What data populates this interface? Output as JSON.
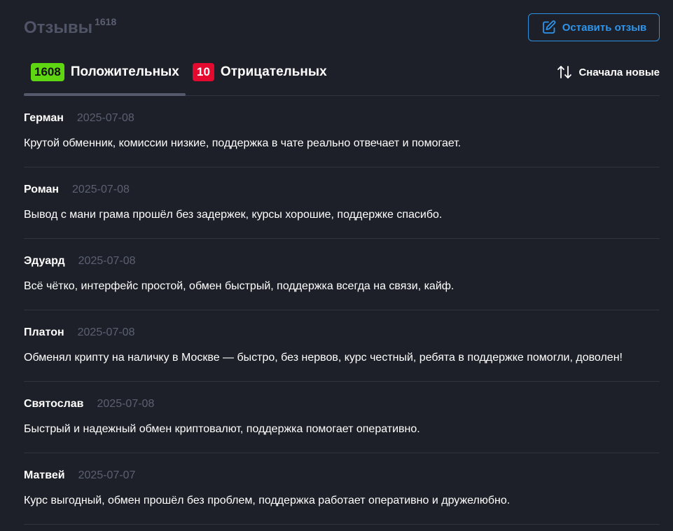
{
  "header": {
    "title": "Отзывы",
    "count": "1618",
    "leave_review_label": "Оставить отзыв"
  },
  "tabs": {
    "positive": {
      "count": "1608",
      "label": "Положительных"
    },
    "negative": {
      "count": "10",
      "label": "Отрицательных"
    }
  },
  "sort": {
    "label": "Сначала новые"
  },
  "reviews": [
    {
      "author": "Герман",
      "date": "2025-07-08",
      "text": "Крутой обменник, комиссии низкие, поддержка в чате реально отвечает и помогает."
    },
    {
      "author": "Роман",
      "date": "2025-07-08",
      "text": "Вывод с мани грама прошёл без задержек, курсы хорошие, поддержке спасибо."
    },
    {
      "author": "Эдуард",
      "date": "2025-07-08",
      "text": "Всё чётко, интерфейс простой, обмен быстрый, поддержка всегда на связи, кайф."
    },
    {
      "author": "Платон",
      "date": "2025-07-08",
      "text": "Обменял крипту на наличку в Москве — быстро, без нервов, курс честный, ребята в поддержке помогли, доволен!"
    },
    {
      "author": "Святослав",
      "date": "2025-07-08",
      "text": "Быстрый и надежный обмен криптовалют, поддержка помогает оперативно."
    },
    {
      "author": "Матвей",
      "date": "2025-07-07",
      "text": "Курс выгодный, обмен прошёл без проблем, поддержка работает оперативно и дружелюбно."
    }
  ],
  "colors": {
    "background": "#1d2028",
    "accent_blue": "#2d95ec",
    "positive_green": "#5ed611",
    "negative_red": "#e3092f",
    "muted_text": "#5b6172",
    "divider": "#30343f"
  },
  "icons": {
    "leave_review": "edit-icon",
    "sort": "sort-arrows-icon"
  }
}
